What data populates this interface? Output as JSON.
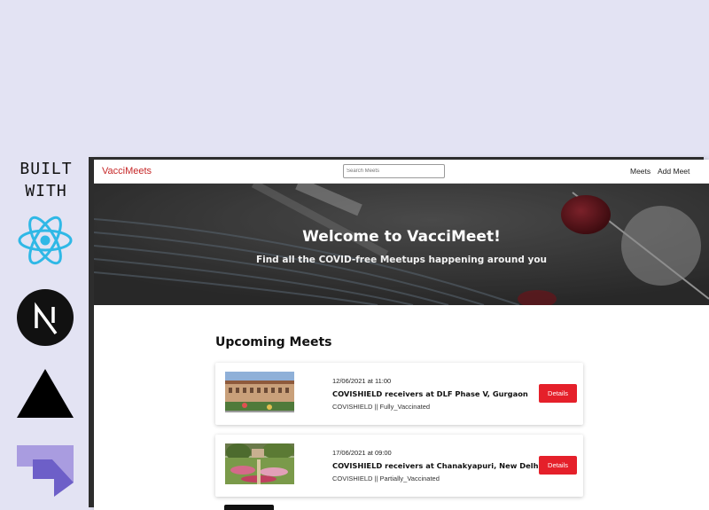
{
  "built_with": {
    "line1": "BUILT",
    "line2": "WITH",
    "logos": [
      "react-logo",
      "nextjs-logo",
      "vercel-logo",
      "prisma-logo"
    ]
  },
  "navbar": {
    "brand": "VacciMeets",
    "search_placeholder": "Search Meets",
    "links": [
      "Meets",
      "Add Meet"
    ]
  },
  "hero": {
    "title": "Welcome to VacciMeet!",
    "subtitle": "Find all the COVID-free Meetups happening around you"
  },
  "section": {
    "title": "Upcoming Meets"
  },
  "meets": [
    {
      "datetime": "12/06/2021 at 11:00",
      "title": "COVISHIELD receivers at DLF Phase V, Gurgaon",
      "tags": "COVISHIELD || Fully_Vaccinated",
      "button": "Details"
    },
    {
      "datetime": "17/06/2021 at 09:00",
      "title": "COVISHIELD receivers at Chanakyapuri, New Delhi",
      "tags": "COVISHIELD || Partially_Vaccinated",
      "button": "Details"
    }
  ],
  "colors": {
    "background": "#e3e3f3",
    "brand": "#c62828",
    "button": "#e5202a",
    "hero": "#3c3c3c",
    "react": "#2fb8e6",
    "prisma": "#7c6fd0"
  }
}
